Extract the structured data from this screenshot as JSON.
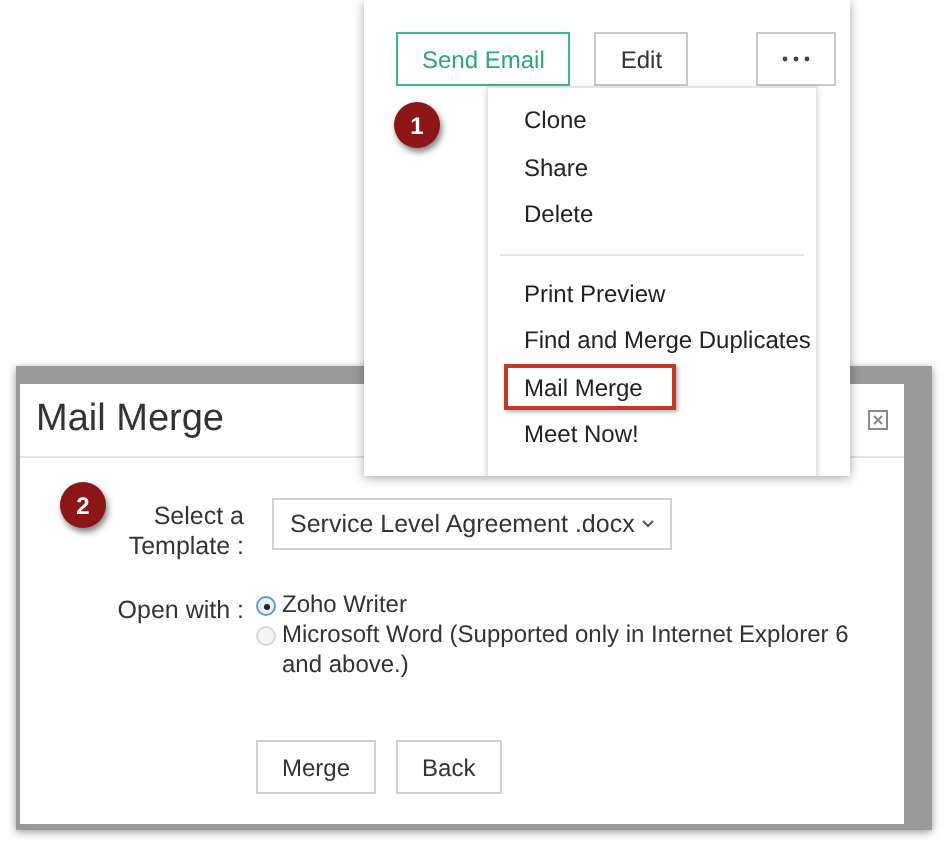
{
  "record_toolbar": {
    "buttons": [
      {
        "label": "Send Email",
        "kind": "primary"
      },
      {
        "label": "Edit",
        "kind": "default"
      },
      {
        "kind": "more"
      }
    ]
  },
  "step_badges": [
    "1",
    "2"
  ],
  "more_menu": {
    "sections": [
      [
        {
          "label": "Clone",
          "selected": false
        },
        {
          "label": "Share",
          "selected": false
        },
        {
          "label": "Delete",
          "selected": false
        }
      ],
      [
        {
          "label": "Print Preview",
          "selected": false
        },
        {
          "label": "Find and Merge Duplicates",
          "selected": false
        },
        {
          "label": "Mail Merge",
          "selected": true
        },
        {
          "label": "Meet Now!",
          "selected": false
        }
      ]
    ]
  },
  "dialog": {
    "title": "Mail Merge",
    "template": {
      "label": "Select a Template :",
      "value": "Service Level Agreement .docx"
    },
    "open_with": {
      "label": "Open with :",
      "options": [
        {
          "label": "Zoho Writer",
          "selected": true
        },
        {
          "label": "Microsoft Word (Supported only in Internet Explorer 6 and above.)",
          "selected": false
        }
      ]
    },
    "buttons": [
      "Merge",
      "Back"
    ]
  }
}
